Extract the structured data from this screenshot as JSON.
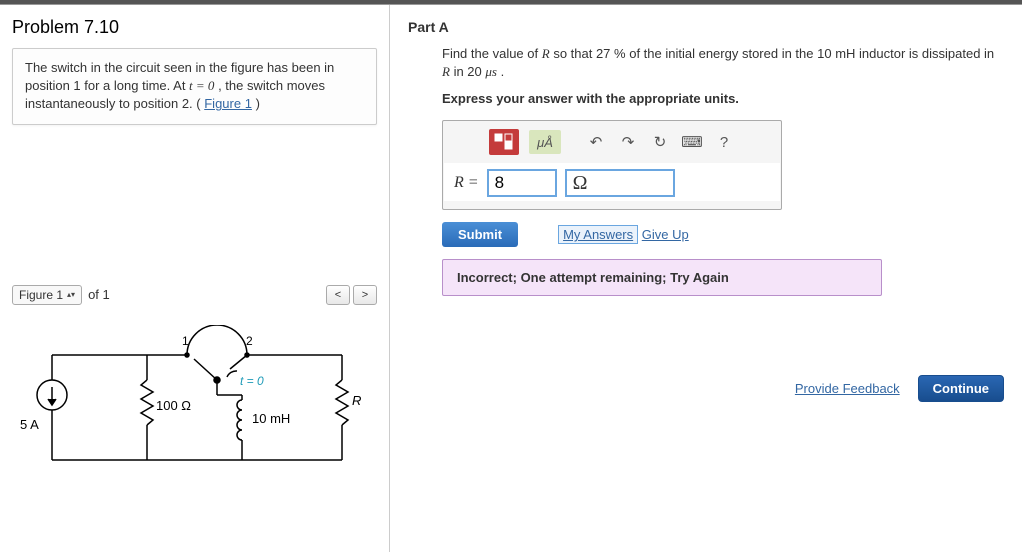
{
  "problem": {
    "title": "Problem 7.10",
    "intro_pre": "The switch in the circuit seen in the figure has been in position 1 for a long time. At ",
    "intro_mid": ", the switch moves instantaneously to position 2. (",
    "intro_link": "Figure 1",
    "intro_post": ")",
    "t_equals_zero": "t = 0"
  },
  "figure": {
    "label": "Figure 1",
    "of_text": "of 1",
    "nav_prev": "<",
    "nav_next": ">",
    "source_label": "5 A",
    "r1_label": "100 Ω",
    "L_label": "10 mH",
    "r2_label": "R",
    "pos1": "1",
    "pos2": "2",
    "t0": "t = 0"
  },
  "partA": {
    "title": "Part A",
    "question_pre": "Find the value of ",
    "q_r": "R",
    "question_mid1": " so that 27 ",
    "percent": "%",
    "question_mid2": " of the initial energy stored in the 10 ",
    "mH": "mH",
    "question_mid3": " inductor is dissipated in ",
    "q_r2": "R",
    "question_mid4": " in 20 ",
    "mus": "μs",
    "question_end": " .",
    "instruction": "Express your answer with the appropriate units.",
    "toolbar": {
      "templates": "□⁄□",
      "units": "μÅ",
      "undo": "↶",
      "redo": "↷",
      "reset": "↻",
      "keyboard": "⌨",
      "help": "?"
    },
    "answer_label": "R = ",
    "answer_value": "8",
    "answer_unit": "Ω",
    "submit": "Submit",
    "my_answers": "My Answers",
    "give_up": "Give Up",
    "feedback": "Incorrect; One attempt remaining; Try Again"
  },
  "footer": {
    "provide_feedback": "Provide Feedback",
    "continue": "Continue"
  }
}
